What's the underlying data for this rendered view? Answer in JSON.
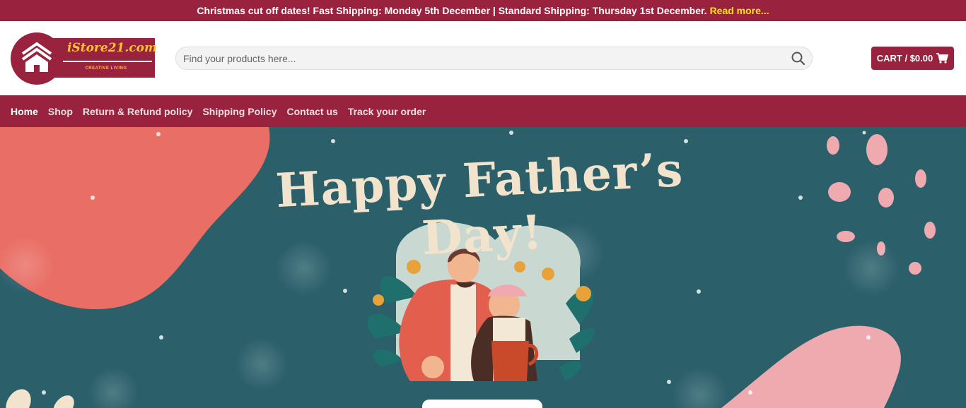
{
  "announcement": {
    "text": "Christmas cut off dates! Fast Shipping: Monday 5th December | Standard Shipping: Thursday 1st December.",
    "link_label": "Read more..."
  },
  "logo": {
    "title": "iStore21.com",
    "tagline": "CREATIVE LIVING"
  },
  "search": {
    "placeholder": "Find your products here...",
    "icon": "search-icon"
  },
  "cart": {
    "label": "CART / $0.00",
    "icon": "shopping-cart-icon"
  },
  "nav": {
    "items": [
      {
        "label": "Home",
        "active": true
      },
      {
        "label": "Shop"
      },
      {
        "label": "Return & Refund policy"
      },
      {
        "label": "Shipping Policy"
      },
      {
        "label": "Contact us"
      },
      {
        "label": "Track your order"
      }
    ]
  },
  "hero": {
    "headline": "Happy Father’s Day!",
    "illustration": "father-and-son-illustration"
  },
  "colors": {
    "brand": "#99223f",
    "accent": "#ffe600",
    "hero_bg": "#2b5f6a",
    "headline": "#f2e4cc",
    "blob_coral": "#e96f66",
    "blob_pink": "#efaab0"
  }
}
